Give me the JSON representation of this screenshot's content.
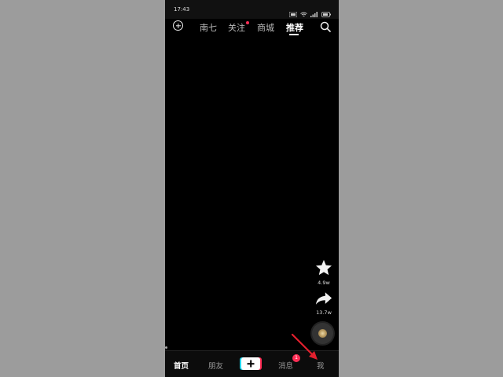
{
  "status_bar": {
    "time": "17:43"
  },
  "top_nav": {
    "tabs": [
      {
        "label": "南七"
      },
      {
        "label": "关注"
      },
      {
        "label": "商城"
      },
      {
        "label": "推荐"
      }
    ],
    "active_tab": "推荐"
  },
  "side_actions": {
    "favorite_count": "4.9w",
    "share_count": "13.7w"
  },
  "bottom_nav": {
    "items": [
      {
        "label": "首页"
      },
      {
        "label": "朋友"
      },
      {
        "label": "消息"
      },
      {
        "label": "我"
      }
    ],
    "messages_badge": "1",
    "active_item": "首页"
  },
  "colors": {
    "accent_red": "#ff2d55",
    "accent_cyan": "#20d5ec",
    "annotation_arrow": "#e3202e"
  }
}
